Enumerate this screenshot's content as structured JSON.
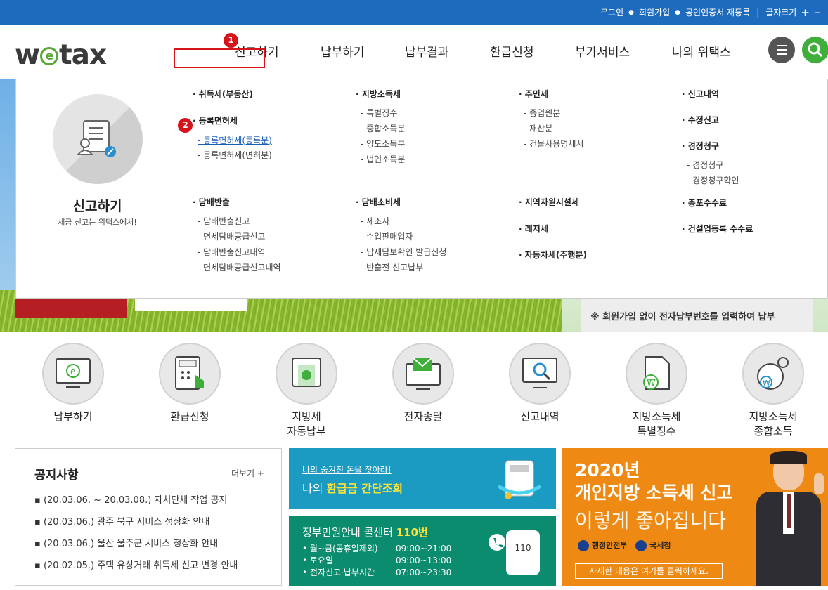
{
  "topbar": {
    "login": "로그인",
    "signup": "회원가입",
    "cert": "공인인증서 재등록",
    "font_size": "글자크기",
    "plus": "+"
  },
  "header": {
    "logo_left": "w",
    "logo_e": "e",
    "logo_right": "tax",
    "nav": [
      "신고하기",
      "납부하기",
      "납부결과",
      "환급신청",
      "부가서비스",
      "나의 위택스"
    ],
    "badge1": "1",
    "badge2": "2"
  },
  "mega": {
    "title": "신고하기",
    "tagline": "세금 신고는 위택스에서!",
    "col1": {
      "h1": "· 취득세(부동산)",
      "h2": "· 등록면허세",
      "h2_items": [
        "- 등록면허세(등록분)",
        "- 등록면허세(면허분)"
      ],
      "h3": "· 담배반출",
      "h3_items": [
        "- 담배반출신고",
        "- 면세담배공급신고",
        "- 담배반출신고내역",
        "- 면세담배공급신고내역"
      ]
    },
    "col2": {
      "h1": "· 지방소득세",
      "h1_items": [
        "- 특별징수",
        "- 종합소득분",
        "- 양도소득분",
        "- 법인소득분"
      ],
      "h2": "· 담배소비세",
      "h2_items": [
        "- 제조자",
        "- 수입판매업자",
        "- 납세담보확인 발급신청",
        "- 반출전 신고납부"
      ]
    },
    "col3": {
      "h1": "· 주민세",
      "h1_items": [
        "- 종업원분",
        "- 재산분",
        "- 건물사용명세서"
      ],
      "h2": "· 지역자원시설세",
      "h3": "· 레저세",
      "h4": "· 자동차세(주행분)"
    },
    "col4": {
      "h1": "· 신고내역",
      "h2": "· 수정신고",
      "h3": "· 경정청구",
      "h3_items": [
        "- 경정청구",
        "- 경정청구확인"
      ],
      "h4": "· 총포수수료",
      "h5": "· 건설업등록 수수료"
    }
  },
  "banner_note": "※ 회원가입 없이 전자납부번호를 입력하여 납부",
  "quick": [
    {
      "label": "납부하기",
      "icon": "monitor-e-icon"
    },
    {
      "label": "환급신청",
      "icon": "calculator-hand-icon"
    },
    {
      "label": "지방세\n자동납부",
      "icon": "auto-pay-icon"
    },
    {
      "label": "전자송달",
      "icon": "email-monitor-icon"
    },
    {
      "label": "신고내역",
      "icon": "monitor-search-icon"
    },
    {
      "label": "지방소득세\n특별징수",
      "icon": "document-won-icon"
    },
    {
      "label": "지방소득세\n종합소득",
      "icon": "pie-gear-won-icon"
    }
  ],
  "notice": {
    "title": "공지사항",
    "more": "더보기 +",
    "items": [
      "(20.03.06. ~ 20.03.08.) 자치단체 작업 공지",
      "(20.03.06.) 광주 북구 서비스 정상화 안내",
      "(20.03.06.) 울산 울주군 서비스 정상화 안내",
      "(20.02.05.) 주택 유상거래 취득세 신고 변경 안내"
    ]
  },
  "refund": {
    "sub": "나의 숨겨진 돈을 찾아라!",
    "title_a": "나의 ",
    "title_b": "환급금 간단조회"
  },
  "callcenter": {
    "title": "정부민원안내 콜센터 ",
    "number": "110번",
    "rows": [
      {
        "label": "• 월~금(공휴일제외)",
        "time": "09:00~21:00"
      },
      {
        "label": "• 토요일",
        "time": "09:00~13:00"
      },
      {
        "label": "• 전자신고·납부시간",
        "time": "07:00~23:30"
      }
    ],
    "phone_label": "110"
  },
  "ad": {
    "line1": "2020년",
    "line2": "개인지방 소득세 신고",
    "line3": "이렇게 좋아집니다",
    "org1": "행정안전부",
    "org2": "국세청",
    "cta": "자세한 내용은 여기를 클릭하세요."
  },
  "colors": {
    "topbar": "#1e6bbd",
    "highlight": "#d6141c",
    "green": "#5aa83a",
    "orange": "#ee8a13",
    "teal": "#0c8c6e",
    "sky": "#1b9ac2"
  }
}
